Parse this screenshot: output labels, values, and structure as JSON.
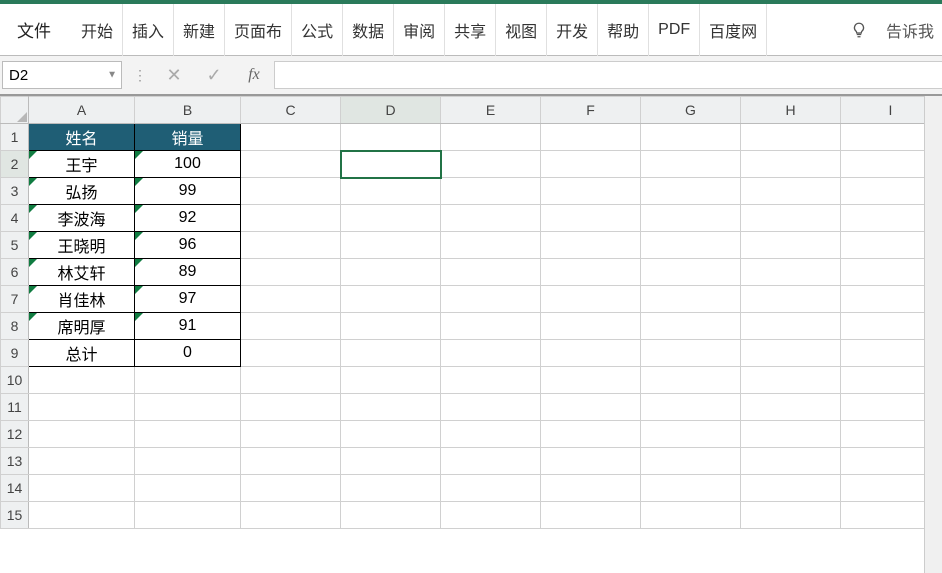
{
  "ribbon": {
    "file": "文件",
    "tabs": [
      "开始",
      "插入",
      "新建",
      "页面布",
      "公式",
      "数据",
      "审阅",
      "共享",
      "视图",
      "开发",
      "帮助",
      "PDF",
      "百度网"
    ],
    "tell_me": "告诉我"
  },
  "formula_bar": {
    "name_box": "D2",
    "cancel": "✕",
    "accept": "✓",
    "fx": "fx",
    "value": ""
  },
  "columns": [
    "A",
    "B",
    "C",
    "D",
    "E",
    "F",
    "G",
    "H",
    "I"
  ],
  "row_count": 15,
  "headers": {
    "name": "姓名",
    "qty": "销量"
  },
  "rows": [
    {
      "name": "王宇",
      "qty": "100"
    },
    {
      "name": "弘扬",
      "qty": "99"
    },
    {
      "name": "李波海",
      "qty": "92"
    },
    {
      "name": "王晓明",
      "qty": "96"
    },
    {
      "name": "林艾轩",
      "qty": "89"
    },
    {
      "name": "肖佳林",
      "qty": "97"
    },
    {
      "name": "席明厚",
      "qty": "91"
    },
    {
      "name": "总计",
      "qty": "0"
    }
  ],
  "selected_cell": "D2"
}
